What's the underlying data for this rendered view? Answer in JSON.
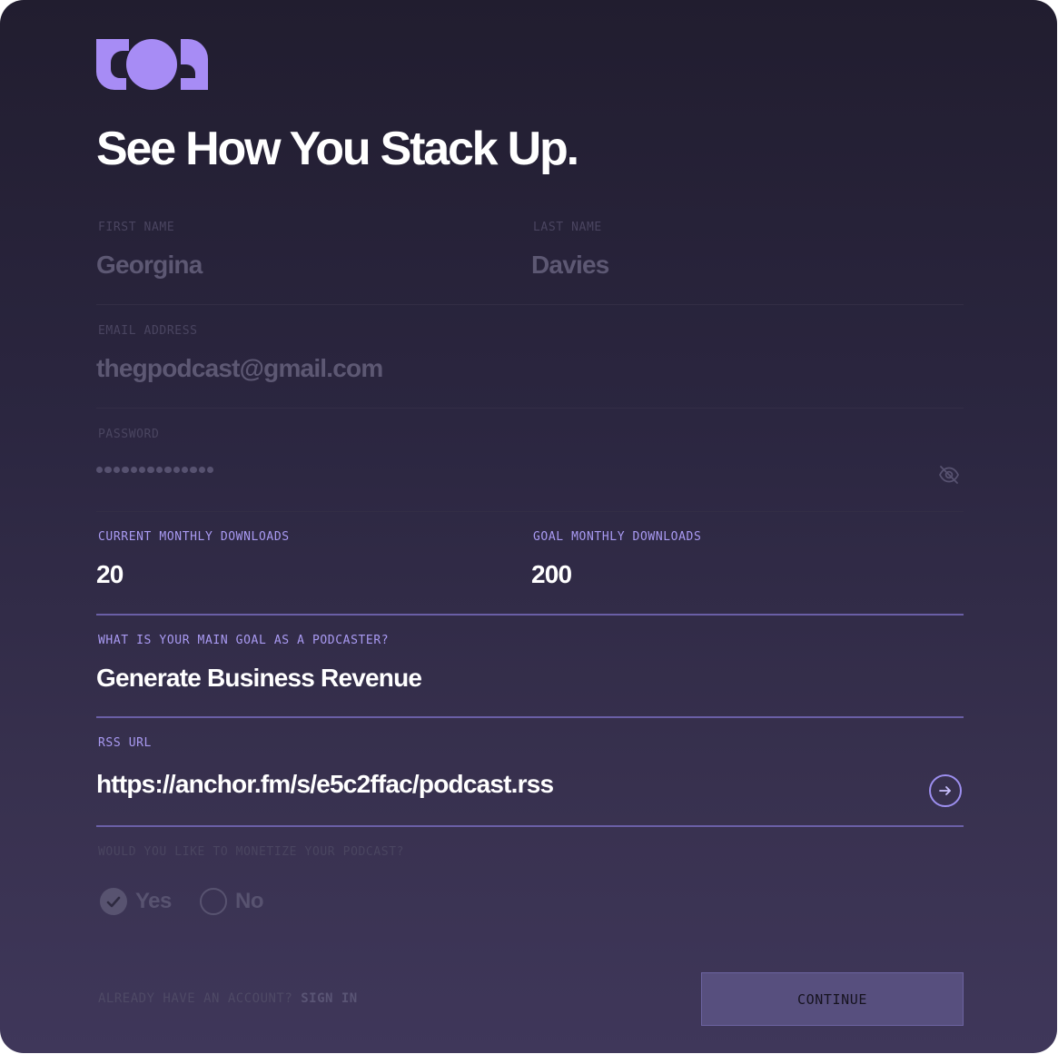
{
  "brand": {
    "logo_icon": "toa-logo",
    "accent": "#a99af2"
  },
  "title": "See How You Stack Up.",
  "form": {
    "first_name": {
      "label": "FIRST NAME",
      "value": "Georgina"
    },
    "last_name": {
      "label": "LAST NAME",
      "value": "Davies"
    },
    "email": {
      "label": "EMAIL ADDRESS",
      "value": "thegpodcast@gmail.com"
    },
    "password": {
      "label": "PASSWORD",
      "masked_length": 14,
      "toggle_icon": "eye-off-icon"
    },
    "current_downloads": {
      "label": "CURRENT MONTHLY DOWNLOADS",
      "value": "20"
    },
    "goal_downloads": {
      "label": "GOAL MONTHLY DOWNLOADS",
      "value": "200"
    },
    "main_goal": {
      "label": "WHAT IS YOUR MAIN GOAL AS A PODCASTER?",
      "value": "Generate Business Revenue"
    },
    "rss": {
      "label": "RSS URL",
      "value": "https://anchor.fm/s/e5c2ffac/podcast.rss",
      "submit_icon": "arrow-right-icon"
    },
    "monetize": {
      "label": "WOULD YOU LIKE TO MONETIZE YOUR PODCAST?",
      "options": [
        {
          "label": "Yes",
          "selected": true
        },
        {
          "label": "No",
          "selected": false
        }
      ]
    }
  },
  "footer": {
    "account_prompt": "ALREADY HAVE AN ACCOUNT?",
    "sign_in": "SIGN IN",
    "continue": "CONTINUE"
  }
}
